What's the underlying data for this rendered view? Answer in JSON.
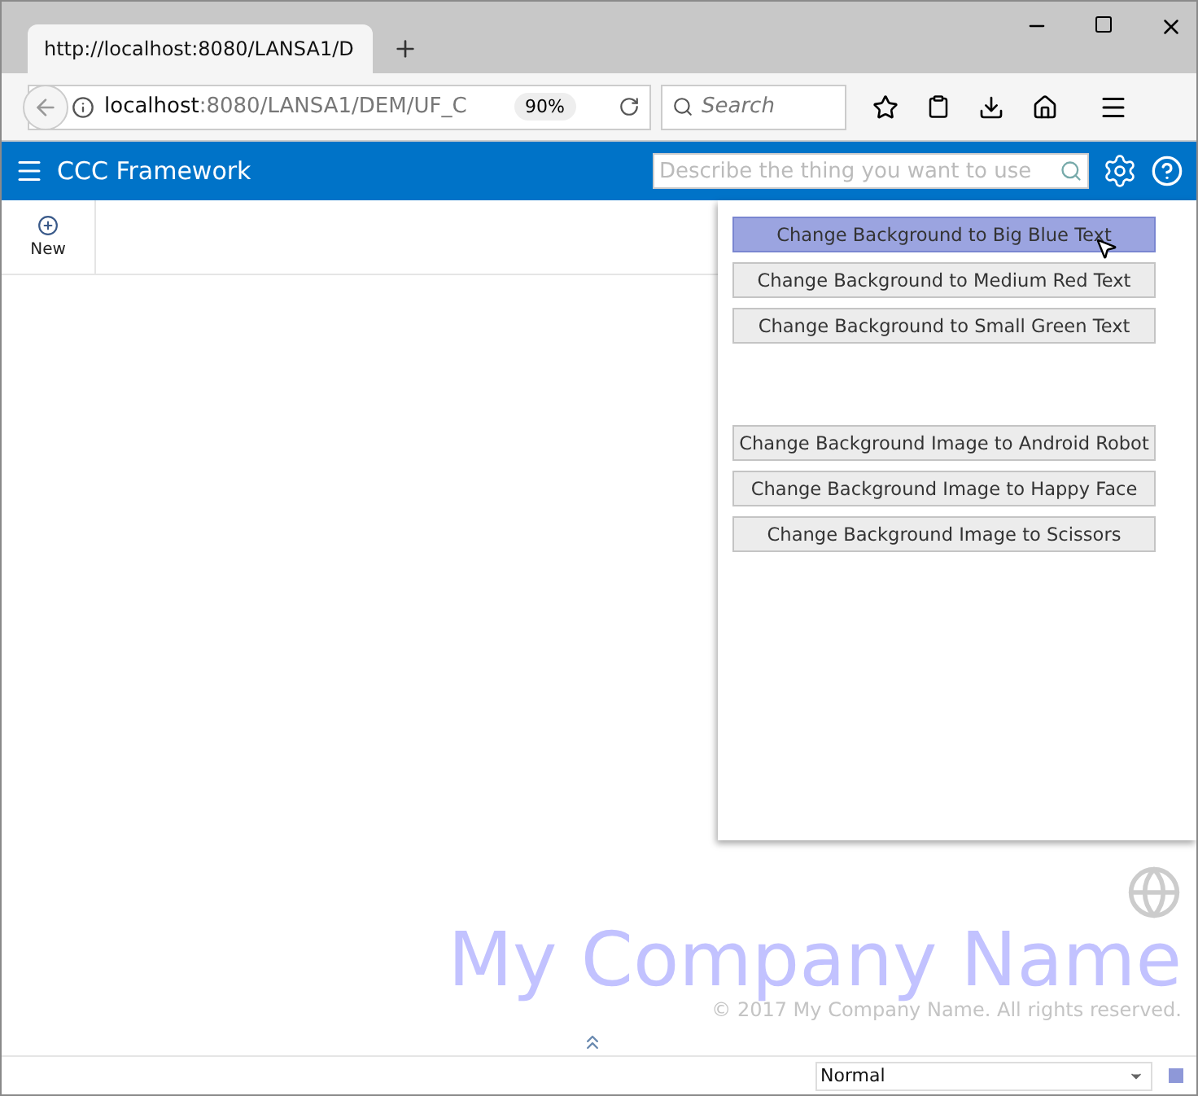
{
  "browser": {
    "tab": {
      "title": "http://localhost:8080/LANSA1/D"
    },
    "address": {
      "host": "localhost",
      "path": ":8080/LANSA1/DEM/UF_C"
    },
    "zoom": "90%",
    "search": {
      "placeholder": "Search"
    }
  },
  "app": {
    "title": "CCC Framework",
    "search": {
      "placeholder": "Describe the thing you want to use"
    }
  },
  "toolbar": [
    {
      "label": "New"
    }
  ],
  "panel": {
    "groups": [
      [
        {
          "label": "Change Background to Big Blue Text",
          "selected": true
        },
        {
          "label": "Change Background to Medium Red Text",
          "selected": false
        },
        {
          "label": "Change Background to Small Green Text",
          "selected": false
        }
      ],
      [
        {
          "label": "Change Background Image to Android Robot",
          "selected": false
        },
        {
          "label": "Change Background Image to Happy Face",
          "selected": false
        },
        {
          "label": "Change Background Image to Scissors",
          "selected": false
        }
      ]
    ]
  },
  "branding": {
    "company": "My Company Name",
    "copyright": "© 2017 My Company Name. All rights reserved."
  },
  "status_bar": {
    "mode": "Normal"
  }
}
